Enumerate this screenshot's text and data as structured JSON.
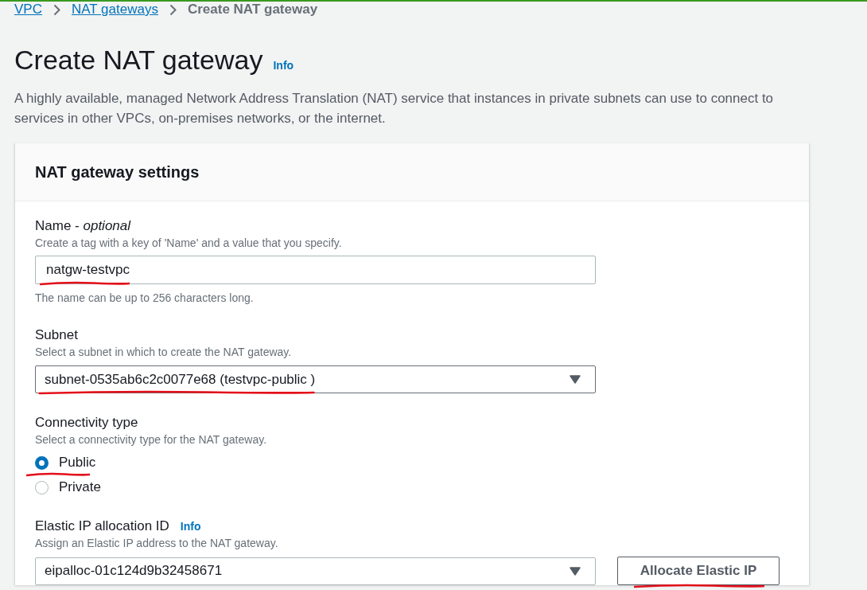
{
  "breadcrumbs": [
    {
      "label": "VPC",
      "kind": "link"
    },
    {
      "label": "NAT gateways",
      "kind": "link"
    },
    {
      "label": "Create NAT gateway",
      "kind": "current"
    }
  ],
  "page": {
    "title": "Create NAT gateway",
    "info_link": "Info",
    "description": "A highly available, managed Network Address Translation (NAT) service that instances in private subnets can use to connect to services in other VPCs, on-premises networks, or the internet."
  },
  "panel": {
    "title": "NAT gateway settings",
    "fields": [
      {
        "kind": "text",
        "label": "Name - *optional*",
        "hint": "Create a tag with a key of 'Name' and a value that you specify.",
        "value": "natgw-testvpc",
        "note": "The name can be up to 256 characters long.",
        "focused": false,
        "underlined": true
      },
      {
        "kind": "select",
        "label": "Subnet",
        "hint": "Select a subnet in which to create the NAT gateway.",
        "value": "subnet-0535ab6c2c0077e68 (testvpc-public )",
        "focused": true,
        "underlined": true
      },
      {
        "kind": "radio",
        "label": "Connectivity type",
        "hint": "Select a connectivity type for the NAT gateway.",
        "options": [
          {
            "label": "Public",
            "selected": true,
            "underlined": true
          },
          {
            "label": "Private",
            "selected": false
          }
        ]
      },
      {
        "kind": "select",
        "label": "Elastic IP allocation ID",
        "info_link": "Info",
        "hint": "Assign an Elastic IP address to the NAT gateway.",
        "value": "eipalloc-01c124d9b32458671",
        "focused": false,
        "button": {
          "label": "Allocate Elastic IP",
          "underlined": true
        }
      }
    ]
  }
}
